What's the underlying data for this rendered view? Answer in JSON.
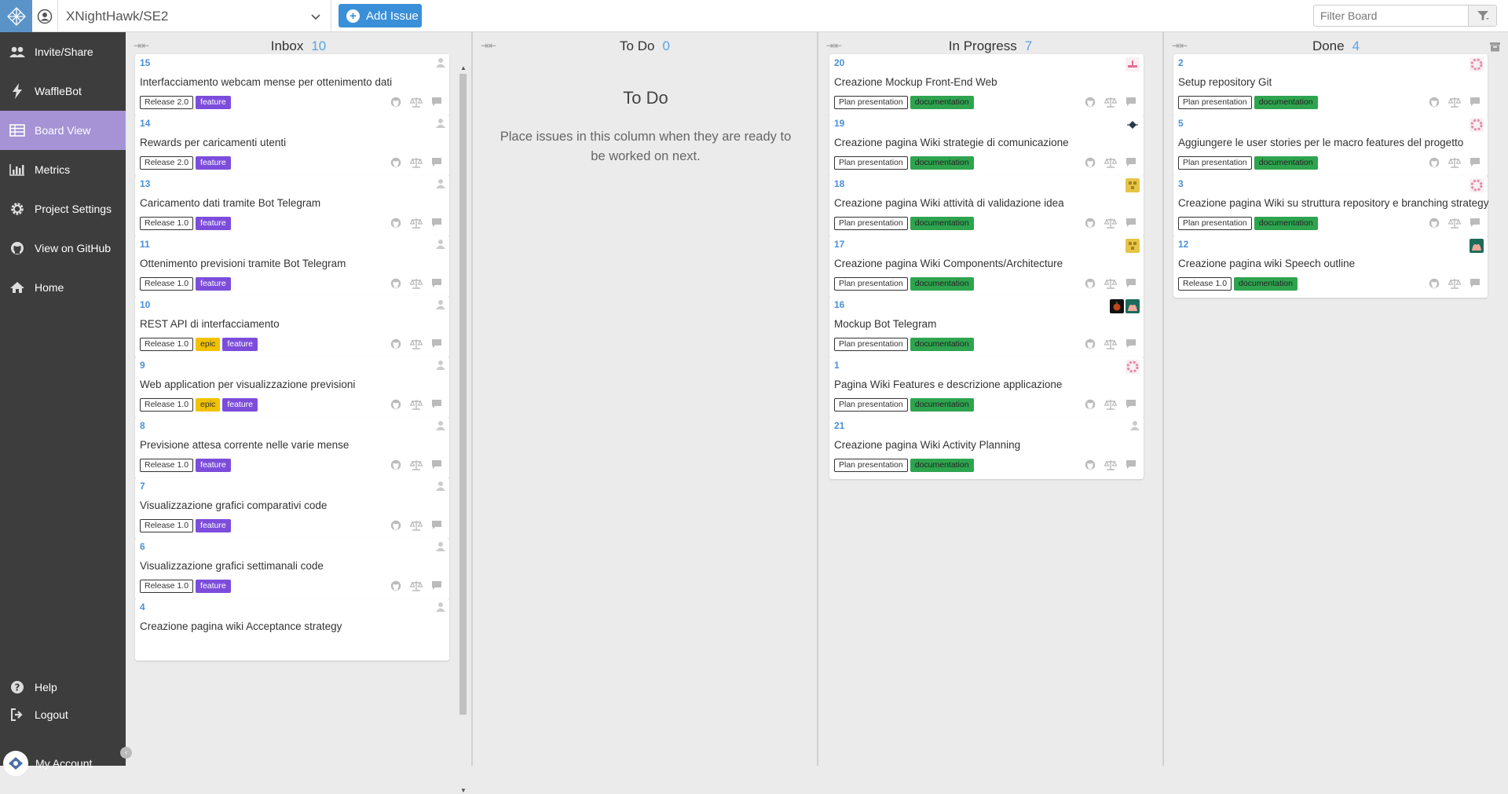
{
  "repo": {
    "name": "XNightHawk/SE2"
  },
  "toolbar": {
    "add_issue": "Add Issue"
  },
  "filter": {
    "placeholder": "Filter Board"
  },
  "sidebar": {
    "items": [
      {
        "label": "Invite/Share",
        "icon": "users-icon"
      },
      {
        "label": "WaffleBot",
        "icon": "bolt-icon"
      },
      {
        "label": "Board View",
        "icon": "table-icon",
        "active": true
      },
      {
        "label": "Metrics",
        "icon": "bar-chart-icon"
      },
      {
        "label": "Project Settings",
        "icon": "gear-icon"
      },
      {
        "label": "View on GitHub",
        "icon": "github-icon"
      },
      {
        "label": "Home",
        "icon": "home-icon"
      }
    ],
    "bottom": [
      {
        "label": "Help",
        "icon": "help-icon"
      },
      {
        "label": "Logout",
        "icon": "logout-icon"
      }
    ],
    "my_account": "My Account"
  },
  "columns": {
    "inbox": {
      "title": "Inbox",
      "count": "10",
      "cards": [
        {
          "num": "15",
          "title": "Interfacciamento webcam mense per ottenimento dati",
          "labels": [
            "Release 2.0",
            "feature"
          ]
        },
        {
          "num": "14",
          "title": "Rewards per caricamenti utenti",
          "labels": [
            "Release 2.0",
            "feature"
          ]
        },
        {
          "num": "13",
          "title": "Caricamento dati tramite Bot Telegram",
          "labels": [
            "Release 1.0",
            "feature"
          ]
        },
        {
          "num": "11",
          "title": "Ottenimento previsioni tramite Bot Telegram",
          "labels": [
            "Release 1.0",
            "feature"
          ]
        },
        {
          "num": "10",
          "title": "REST API di interfacciamento",
          "labels": [
            "Release 1.0",
            "epic",
            "feature"
          ]
        },
        {
          "num": "9",
          "title": "Web application per visualizzazione previsioni",
          "labels": [
            "Release 1.0",
            "epic",
            "feature"
          ]
        },
        {
          "num": "8",
          "title": "Previsione attesa corrente nelle varie mense",
          "labels": [
            "Release 1.0",
            "feature"
          ]
        },
        {
          "num": "7",
          "title": "Visualizzazione grafici comparativi code",
          "labels": [
            "Release 1.0",
            "feature"
          ]
        },
        {
          "num": "6",
          "title": "Visualizzazione grafici settimanali code",
          "labels": [
            "Release 1.0",
            "feature"
          ]
        },
        {
          "num": "4",
          "title": "Creazione pagina wiki Acceptance strategy",
          "labels": []
        }
      ]
    },
    "todo": {
      "title": "To Do",
      "count": "0",
      "empty_title": "To Do",
      "empty_text": "Place issues in this column when they are ready to be worked on next."
    },
    "in_progress": {
      "title": "In Progress",
      "count": "7",
      "cards": [
        {
          "num": "20",
          "title": "Creazione Mockup Front-End Web",
          "labels": [
            "Plan presentation",
            "documentation"
          ]
        },
        {
          "num": "19",
          "title": "Creazione pagina Wiki strategie di comunicazione",
          "labels": [
            "Plan presentation",
            "documentation"
          ]
        },
        {
          "num": "18",
          "title": "Creazione pagina Wiki attività di validazione idea",
          "labels": [
            "Plan presentation",
            "documentation"
          ]
        },
        {
          "num": "17",
          "title": "Creazione pagina Wiki Components/Architecture",
          "labels": [
            "Plan presentation",
            "documentation"
          ]
        },
        {
          "num": "16",
          "title": "Mockup Bot Telegram",
          "labels": [
            "Plan presentation",
            "documentation"
          ]
        },
        {
          "num": "1",
          "title": "Pagina Wiki Features e descrizione applicazione",
          "labels": [
            "Plan presentation",
            "documentation"
          ]
        },
        {
          "num": "21",
          "title": "Creazione pagina Wiki Activity Planning",
          "labels": [
            "Plan presentation",
            "documentation"
          ]
        }
      ]
    },
    "done": {
      "title": "Done",
      "count": "4",
      "cards": [
        {
          "num": "2",
          "title": "Setup repository Git",
          "labels": [
            "Plan presentation",
            "documentation"
          ]
        },
        {
          "num": "5",
          "title": "Aggiungere le user stories per le macro features del progetto",
          "labels": [
            "Plan presentation",
            "documentation"
          ]
        },
        {
          "num": "3",
          "title": "Creazione pagina Wiki su struttura repository e branching strategy",
          "labels": [
            "Plan presentation",
            "documentation"
          ]
        },
        {
          "num": "12",
          "title": "Creazione pagina wiki Speech outline",
          "labels": [
            "Release 1.0",
            "documentation"
          ]
        }
      ]
    }
  },
  "colors": {
    "accent": "#3a8fd9",
    "sidebar": "#3d3d3d",
    "active_nav": "#a593d6",
    "feature": "#7c4ddb",
    "epic": "#f2c200",
    "documentation": "#2ea44f"
  }
}
